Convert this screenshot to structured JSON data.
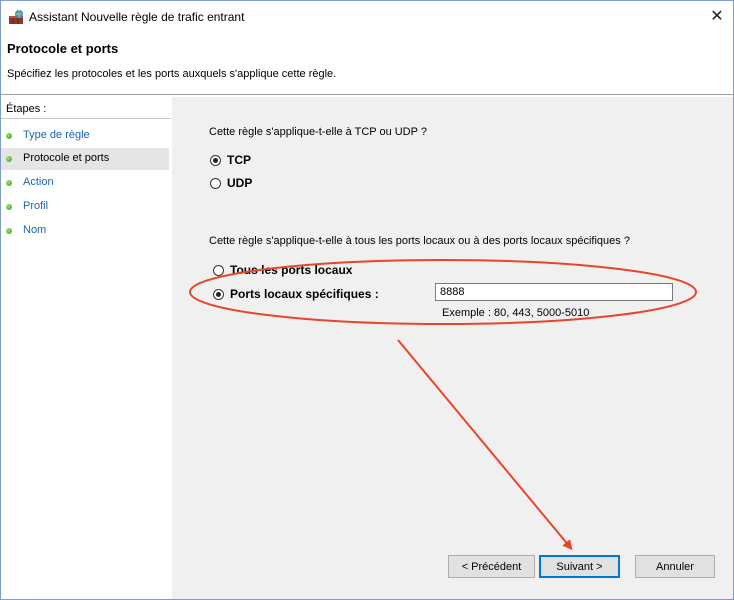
{
  "window": {
    "title": "Assistant Nouvelle règle de trafic entrant",
    "close_glyph": "✕"
  },
  "header": {
    "title": "Protocole et ports",
    "description": "Spécifiez les protocoles et les ports auxquels s'applique cette règle."
  },
  "sidebar": {
    "title": "Étapes :",
    "items": [
      {
        "label": "Type de règle",
        "active": false
      },
      {
        "label": "Protocole et ports",
        "active": true
      },
      {
        "label": "Action",
        "active": false
      },
      {
        "label": "Profil",
        "active": false
      },
      {
        "label": "Nom",
        "active": false
      }
    ]
  },
  "content": {
    "protocol_question": "Cette règle s'applique-t-elle à TCP ou UDP ?",
    "protocol_options": [
      {
        "label": "TCP",
        "checked": true
      },
      {
        "label": "UDP",
        "checked": false
      }
    ],
    "ports_question": "Cette règle s'applique-t-elle à tous les ports locaux ou à des ports locaux spécifiques ?",
    "ports_options": [
      {
        "label": "Tous les ports locaux",
        "checked": false
      },
      {
        "label": "Ports locaux spécifiques :",
        "checked": true
      }
    ],
    "port_value": "8888",
    "port_example": "Exemple : 80, 443, 5000-5010"
  },
  "buttons": {
    "previous": "< Précédent",
    "next": "Suivant >",
    "cancel": "Annuler"
  },
  "annotation": {
    "color": "#e8452b"
  }
}
